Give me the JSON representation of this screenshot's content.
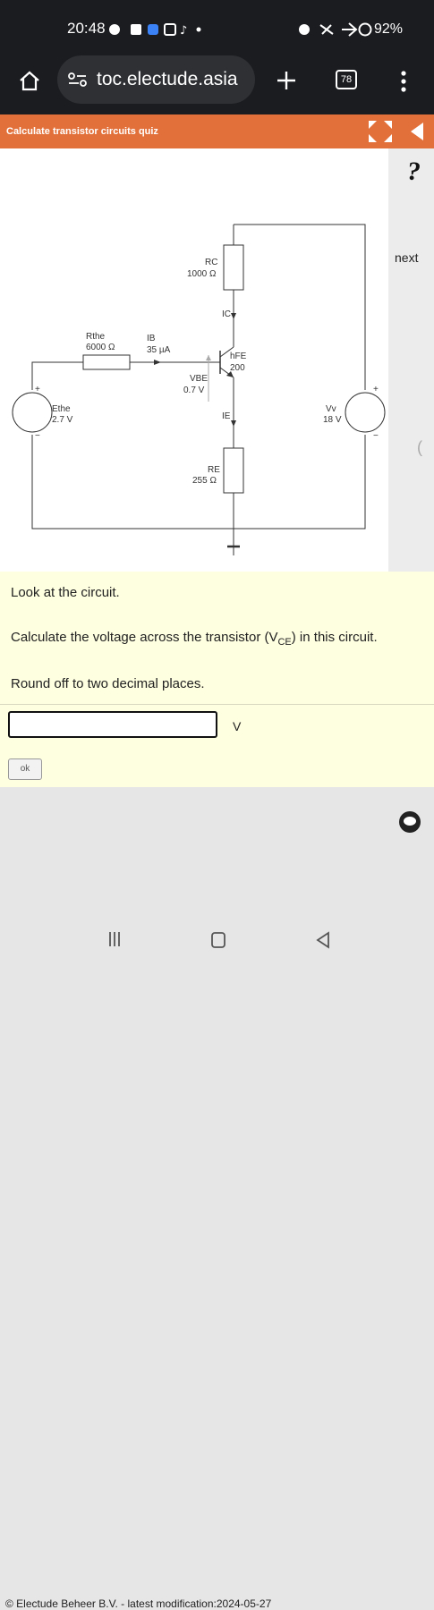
{
  "status": {
    "time": "20:48",
    "battery": "92%"
  },
  "browser": {
    "url": "toc.electude.asia",
    "tab_count": "78"
  },
  "quiz": {
    "title": "Calculate transistor circuits quiz",
    "next_label": "next",
    "help_label": "?"
  },
  "circuit": {
    "rthe_label": "Rthe",
    "rthe_value": "6000 Ω",
    "ib_label": "IB",
    "ib_value": "35 µA",
    "rc_label": "RC",
    "rc_value": "1000 Ω",
    "ic_label": "IC",
    "hfe_label": "hFE",
    "hfe_value": "200",
    "vbe_label": "VBE",
    "vbe_value": "0.7 V",
    "ie_label": "IE",
    "re_label": "RE",
    "re_value": "255 Ω",
    "ethe_label": "Ethe",
    "ethe_value": "2.7 V",
    "vv_label": "Vv",
    "vv_value": "18 V",
    "plus": "+",
    "minus": "−"
  },
  "question": {
    "line1": "Look at the circuit.",
    "line2_pre": "Calculate the voltage across the transistor (V",
    "line2_sub": "CE",
    "line2_post": ") in this circuit.",
    "line3": "Round off to two decimal places.",
    "answer_value": "",
    "unit": "V",
    "ok_label": "ok"
  },
  "footer": {
    "copyright": "© Electude Beheer B.V. - latest modification:2024-05-27"
  },
  "colors": {
    "header_orange": "#e2703a",
    "question_bg": "#fefee0",
    "status_bg": "#1b1c20"
  }
}
